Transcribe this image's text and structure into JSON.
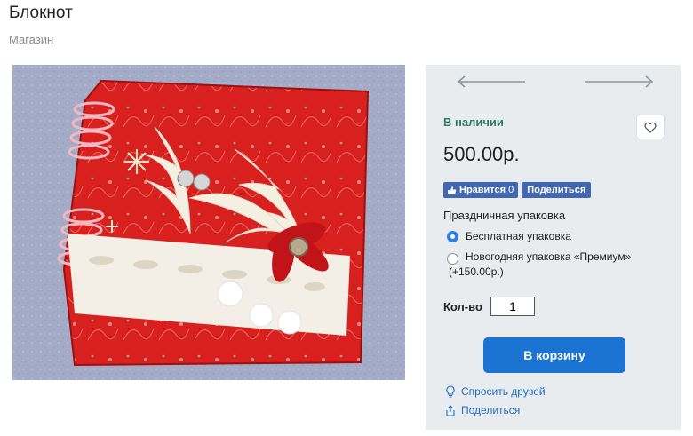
{
  "page": {
    "title": "Блокнот",
    "breadcrumb": "Магазин"
  },
  "product_image": {
    "alt": "",
    "colors": {
      "background": "#9fa7c2",
      "cover_red": "#d41c1c",
      "spiral": "#f2b8c2",
      "lace": "#f3efe6"
    }
  },
  "panel": {
    "prev_icon": "arrow-left-icon",
    "next_icon": "arrow-right-icon",
    "availability": "В наличии",
    "favorite_icon": "heart-icon",
    "price": "500.00р.",
    "social": {
      "like_label": "Нравится",
      "like_count": "0",
      "share_label": "Поделиться"
    },
    "packaging": {
      "title": "Праздничная упаковка",
      "options": [
        {
          "label": "Бесплатная упаковка",
          "selected": true
        },
        {
          "label_line1": "Новогодняя упаковка «Премиум»",
          "label_line2": "(+150.00р.)",
          "selected": false
        }
      ]
    },
    "quantity": {
      "label": "Кол-во",
      "value": "1"
    },
    "add_to_cart": "В корзину",
    "links": {
      "ask_friends": "Спросить друзей",
      "share": "Поделиться"
    }
  },
  "colors": {
    "accent": "#1b74d1",
    "in_stock": "#2f7a63",
    "facebook": "#4267b2",
    "panel_bg": "#e9ecef",
    "link": "#1f6fc4"
  }
}
